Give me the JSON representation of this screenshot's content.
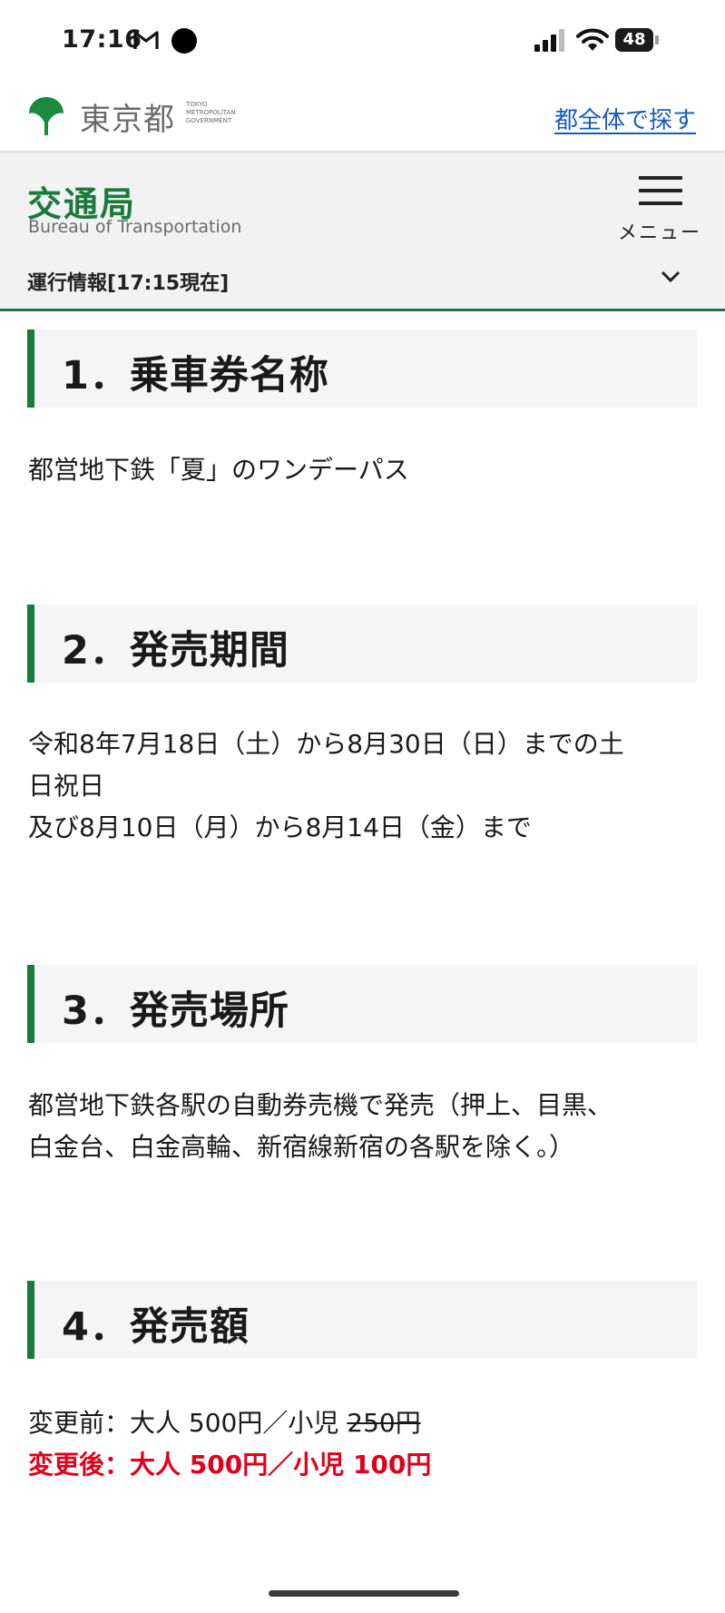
{
  "status_bar": {
    "time": "17:16",
    "battery": "48",
    "icons": [
      "gmail-icon",
      "notification-dot-icon",
      "cellular-signal-icon",
      "wifi-icon",
      "battery-icon"
    ]
  },
  "metro_header": {
    "logo_text": "東京都",
    "logo_sub": [
      "TOKYO",
      "METROPOLITAN",
      "GOVERNMENT"
    ],
    "search_link": "都全体で探す",
    "brand_color": "#1a7a3e"
  },
  "bureau_header": {
    "title": "交通局",
    "subtitle": "Bureau of Transportation",
    "menu_label": "メニュー",
    "operation_info": "運行情報[17:15現在]"
  },
  "sections": [
    {
      "heading": "1．乗車券名称",
      "lines": [
        "都営地下鉄「夏」のワンデーパス"
      ]
    },
    {
      "heading": "2．発売期間",
      "lines": [
        "令和8年7月18日（土）から8月30日（日）までの土",
        "日祝日",
        "及び8月10日（月）から8月14日（金）まで"
      ]
    },
    {
      "heading": "3．発売場所",
      "lines": [
        "都営地下鉄各駅の自動券売機で発売（押上、目黒、",
        "白金台、白金高輪、新宿線新宿の各駅を除く。）"
      ]
    },
    {
      "heading": "4．発売額",
      "before_prefix": "変更前：大人 500円／小児 ",
      "before_struck": "250円",
      "after": "変更後：大人 500円／小児 100円",
      "alert_color": "#e0001b"
    }
  ]
}
